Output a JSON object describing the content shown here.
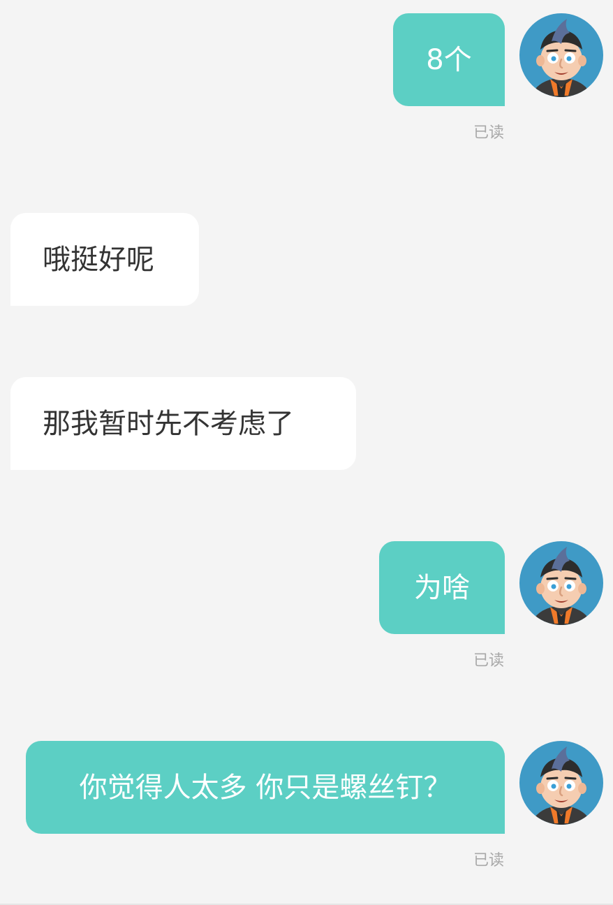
{
  "messages": [
    {
      "direction": "outgoing",
      "text": "8个",
      "status": "已读"
    },
    {
      "direction": "incoming",
      "text": "哦挺好呢"
    },
    {
      "direction": "incoming",
      "text": "那我暂时先不考虑了"
    },
    {
      "direction": "outgoing",
      "text": "为啥",
      "status": "已读"
    },
    {
      "direction": "outgoing",
      "text": "你觉得人太多 你只是螺丝钉？",
      "status": "已读"
    }
  ],
  "colors": {
    "background": "#f4f4f4",
    "outgoing_bubble": "#5ccfc4",
    "incoming_bubble": "#ffffff",
    "avatar_background": "#3f9ac6"
  },
  "icons": {
    "avatar": "cartoon-man-avatar-icon"
  }
}
